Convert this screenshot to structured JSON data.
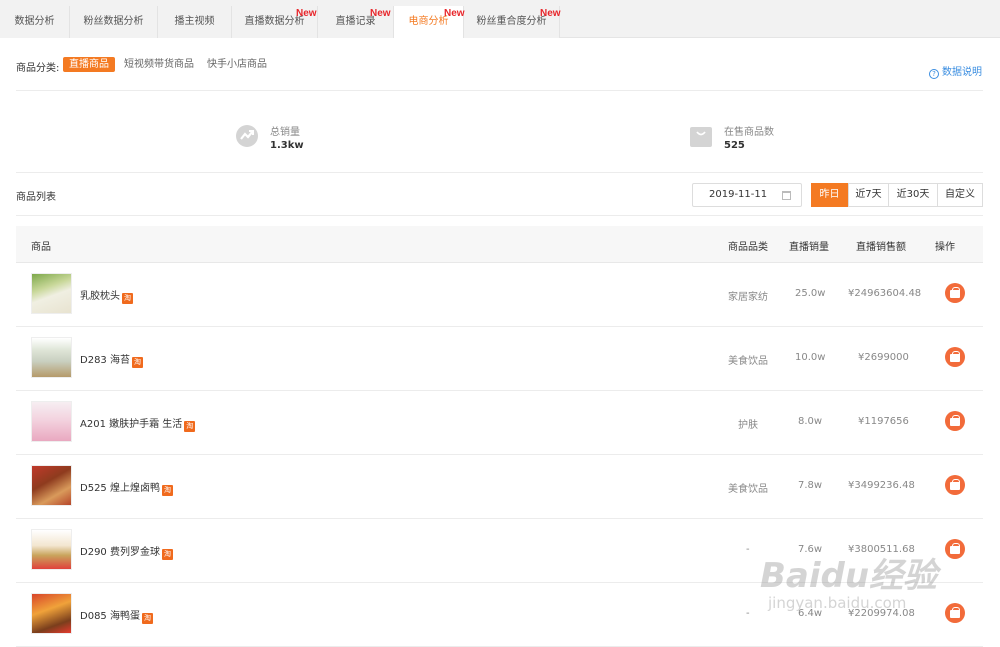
{
  "tabs": [
    {
      "label": "数据分析",
      "new": ""
    },
    {
      "label": "粉丝数据分析",
      "new": ""
    },
    {
      "label": "播主视频",
      "new": ""
    },
    {
      "label": "直播数据分析",
      "new": "New"
    },
    {
      "label": "直播记录",
      "new": "New"
    },
    {
      "label": "电商分析",
      "new": "New"
    },
    {
      "label": "粉丝重合度分析",
      "new": "New"
    }
  ],
  "category": {
    "label": "商品分类:",
    "items": [
      "直播商品",
      "短视频带货商品",
      "快手小店商品"
    ],
    "active": "直播商品"
  },
  "help_label": "数据说明",
  "stats": {
    "total_sales_label": "总销量",
    "total_sales_value": "1.3kw",
    "on_sale_label": "在售商品数",
    "on_sale_value": "525"
  },
  "list": {
    "title": "商品列表",
    "date": "2019-11-11",
    "ranges": [
      "昨日",
      "近7天",
      "近30天",
      "自定义"
    ]
  },
  "table": {
    "headers": {
      "product": "商品",
      "category": "商品品类",
      "sales": "直播销量",
      "amount": "直播销售额",
      "op": "操作"
    },
    "taobao_badge": "淘",
    "rows": [
      {
        "name": "乳胶枕头",
        "category": "家居家纺",
        "sales": "25.0w",
        "amount": "¥24963604.48"
      },
      {
        "name": "D283 海苔",
        "category": "美食饮品",
        "sales": "10.0w",
        "amount": "¥2699000"
      },
      {
        "name": "A201 嫩肤护手霜 生活",
        "category": "护肤",
        "sales": "8.0w",
        "amount": "¥1197656"
      },
      {
        "name": "D525 煌上煌卤鸭",
        "category": "美食饮品",
        "sales": "7.8w",
        "amount": "¥3499236.48"
      },
      {
        "name": "D290 费列罗金球",
        "category": "-",
        "sales": "7.6w",
        "amount": "¥3800511.68"
      },
      {
        "name": "D085 海鸭蛋",
        "category": "-",
        "sales": "6.4w",
        "amount": "¥2209974.08"
      }
    ]
  },
  "colors": {
    "accent": "#f47a22",
    "new_badge": "#e8262b",
    "link": "#3a8de0",
    "op_button": "#f26b3a"
  },
  "watermark": {
    "main": "Baidu经验",
    "sub": "jingyan.baidu.com"
  }
}
